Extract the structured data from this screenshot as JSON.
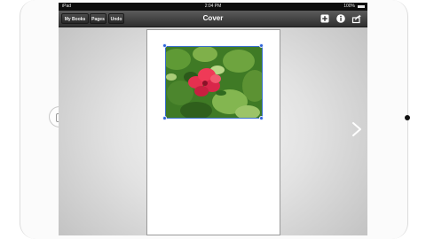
{
  "status_bar": {
    "carrier": "iPad",
    "time": "2:04 PM",
    "battery": "100%"
  },
  "toolbar": {
    "my_books_label": "My Books",
    "pages_label": "Pages",
    "undo_label": "Undo",
    "title": "Cover",
    "icons": [
      "add-icon",
      "info-icon",
      "share-icon"
    ]
  },
  "navigation": {
    "next_page_icon": "chevron-right-icon"
  },
  "page": {
    "image_subject": "red hibiscus flower"
  },
  "colors": {
    "toolbar": "#3c3c3c",
    "selection_handle": "#2e63d8",
    "flower": "#e5304f",
    "foliage": "#3f7a25"
  }
}
